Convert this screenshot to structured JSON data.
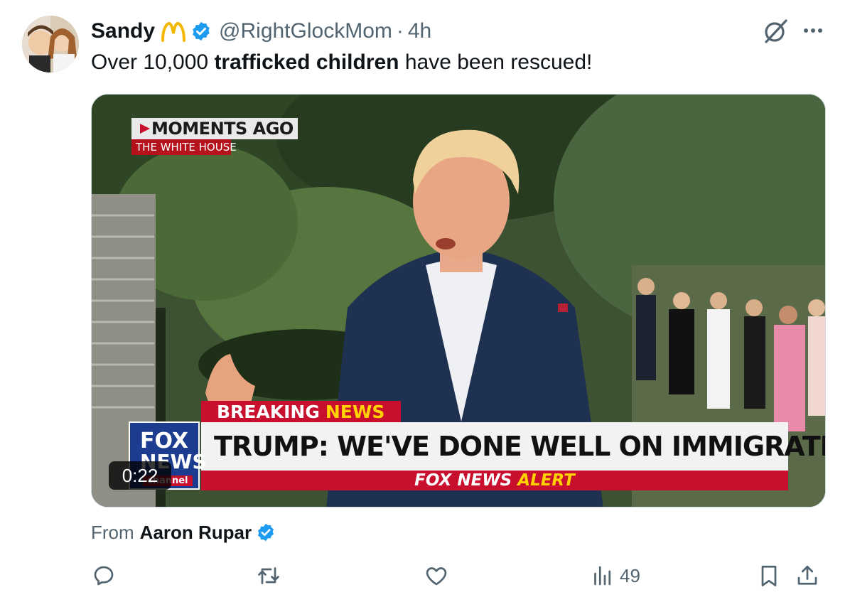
{
  "tweet": {
    "display_name": "Sandy",
    "handle": "@RightGlockMom",
    "separator": "·",
    "time": "4h",
    "text_before": "Over 10,000 ",
    "text_bold": "trafficked children",
    "text_after": " have been rescued!"
  },
  "media": {
    "overlay_small_1": "MOMENTS AGO",
    "overlay_small_2": "THE WHITE HOUSE",
    "breaking_1": "BREAKING",
    "breaking_2": "NEWS",
    "headline": "TRUMP: WE'VE DONE WELL ON IMMIGRATION",
    "alert_1": "FOX NEWS",
    "alert_2": "ALERT",
    "logo_1": "FOX",
    "logo_2": "NEWS",
    "logo_3": "channel",
    "duration": "0:22"
  },
  "attribution": {
    "label": "From",
    "author": "Aaron Rupar"
  },
  "actions": {
    "views_count": "49"
  },
  "icons": {
    "verified": "verified-badge-icon",
    "emoji": "golden-arches-icon",
    "grok": "grok-icon",
    "more": "more-icon",
    "reply": "reply-icon",
    "retweet": "retweet-icon",
    "like": "like-icon",
    "views": "views-icon",
    "bookmark": "bookmark-icon",
    "share": "share-icon"
  },
  "colors": {
    "verified": "#1d9bf0",
    "text_primary": "#0f1419",
    "text_secondary": "#536471",
    "fox_red": "#c8102e",
    "fox_yellow": "#ffd200"
  }
}
